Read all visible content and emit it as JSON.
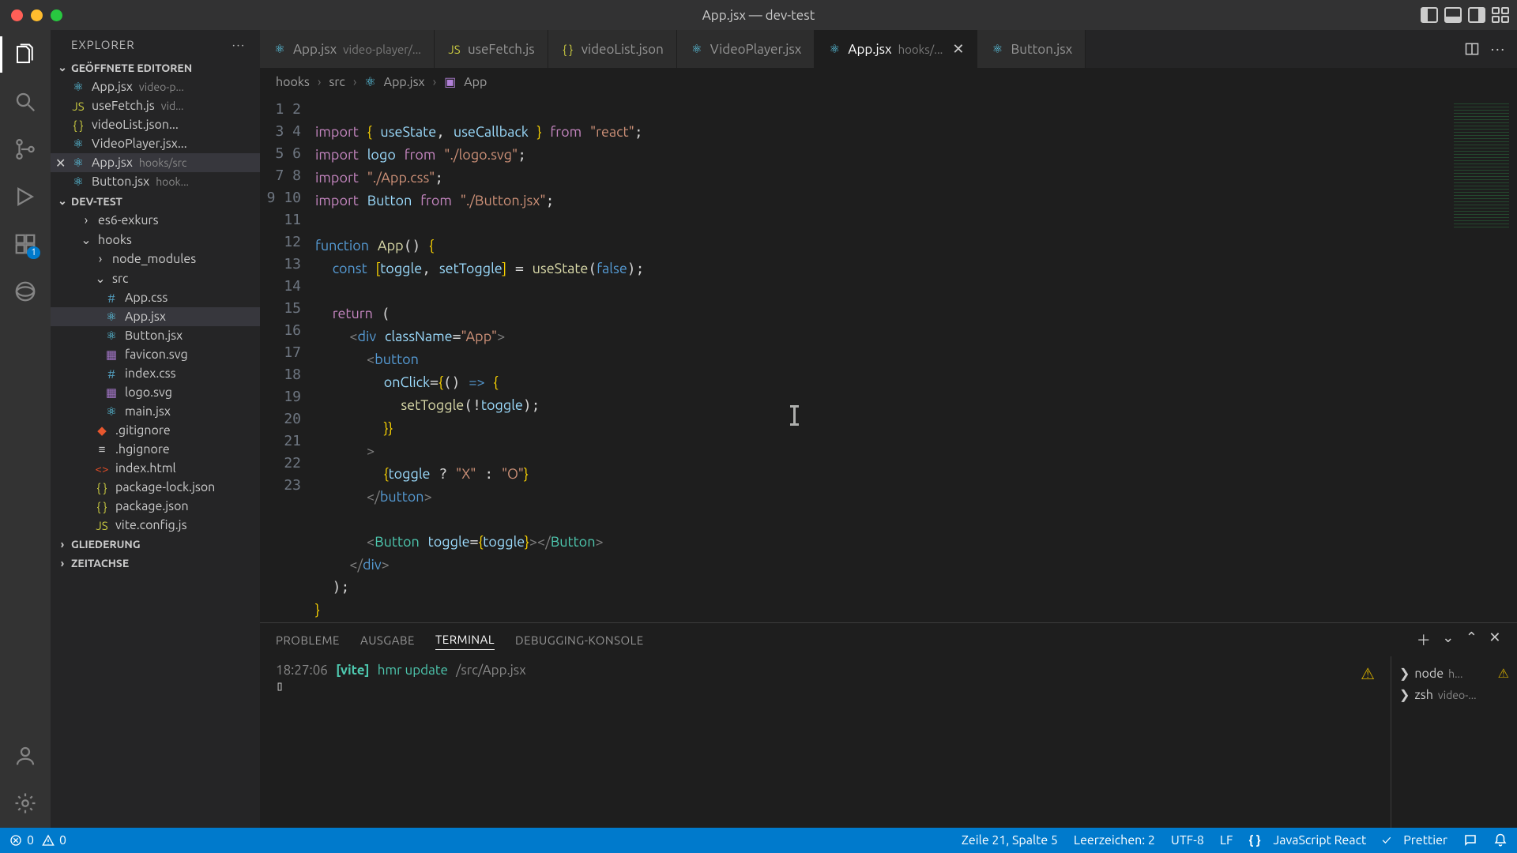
{
  "window": {
    "title": "App.jsx — dev-test"
  },
  "activity": {
    "extensions_badge": "1"
  },
  "sidebar": {
    "title": "EXPLORER",
    "sections": {
      "open_editors": "GEÖFFNETE EDITOREN",
      "project": "DEV-TEST",
      "outline": "GLIEDERUNG",
      "timeline": "ZEITACHSE"
    },
    "open_editors": [
      {
        "icon": "react",
        "name": "App.jsx",
        "hint": "video-p..."
      },
      {
        "icon": "js",
        "name": "useFetch.js",
        "hint": "vid..."
      },
      {
        "icon": "json",
        "name": "videoList.json...",
        "hint": ""
      },
      {
        "icon": "react",
        "name": "VideoPlayer.jsx...",
        "hint": ""
      },
      {
        "icon": "react",
        "name": "App.jsx",
        "hint": "hooks/src",
        "active": true,
        "close": true
      },
      {
        "icon": "react",
        "name": "Button.jsx",
        "hint": "hook..."
      }
    ],
    "tree": [
      {
        "depth": 1,
        "chev": ">",
        "icon": "folder",
        "name": "es6-exkurs"
      },
      {
        "depth": 1,
        "chev": "v",
        "icon": "folder",
        "name": "hooks"
      },
      {
        "depth": 2,
        "chev": ">",
        "icon": "folder",
        "name": "node_modules"
      },
      {
        "depth": 2,
        "chev": "v",
        "icon": "folder",
        "name": "src"
      },
      {
        "depth": 3,
        "icon": "css",
        "name": "App.css"
      },
      {
        "depth": 3,
        "icon": "react",
        "name": "App.jsx",
        "active": true
      },
      {
        "depth": 3,
        "icon": "react",
        "name": "Button.jsx"
      },
      {
        "depth": 3,
        "icon": "svg",
        "name": "favicon.svg"
      },
      {
        "depth": 3,
        "icon": "css",
        "name": "index.css"
      },
      {
        "depth": 3,
        "icon": "svg",
        "name": "logo.svg"
      },
      {
        "depth": 3,
        "icon": "react",
        "name": "main.jsx"
      },
      {
        "depth": 2,
        "icon": "git",
        "name": ".gitignore"
      },
      {
        "depth": 2,
        "icon": "",
        "name": ".hgignore"
      },
      {
        "depth": 2,
        "icon": "html",
        "name": "index.html"
      },
      {
        "depth": 2,
        "icon": "json",
        "name": "package-lock.json"
      },
      {
        "depth": 2,
        "icon": "json",
        "name": "package.json"
      },
      {
        "depth": 2,
        "icon": "js",
        "name": "vite.config.js"
      }
    ]
  },
  "tabs": [
    {
      "icon": "react",
      "label": "App.jsx",
      "hint": "video-player/..."
    },
    {
      "icon": "js",
      "label": "useFetch.js"
    },
    {
      "icon": "json",
      "label": "videoList.json"
    },
    {
      "icon": "react",
      "label": "VideoPlayer.jsx"
    },
    {
      "icon": "react",
      "label": "App.jsx",
      "hint": "hooks/...",
      "active": true,
      "close": true
    },
    {
      "icon": "react",
      "label": "Button.jsx"
    }
  ],
  "breadcrumbs": [
    "hooks",
    "src",
    "App.jsx",
    "App"
  ],
  "code_lines": 23,
  "panel": {
    "tabs": {
      "problems": "PROBLEME",
      "output": "AUSGABE",
      "terminal": "TERMINAL",
      "debug": "DEBUGGING-KONSOLE"
    },
    "terminal_line": {
      "time": "18:27:06",
      "tag": "[vite]",
      "msg": "hmr update",
      "path": "/src/App.jsx"
    },
    "shells": [
      {
        "name": "node",
        "hint": "h...",
        "warn": true
      },
      {
        "name": "zsh",
        "hint": "video-..."
      }
    ]
  },
  "status": {
    "errors": "0",
    "warnings": "0",
    "pos": "Zeile 21, Spalte 5",
    "indent": "Leerzeichen: 2",
    "enc": "UTF-8",
    "eol": "LF",
    "lang": "JavaScript React",
    "prettier": "Prettier"
  }
}
